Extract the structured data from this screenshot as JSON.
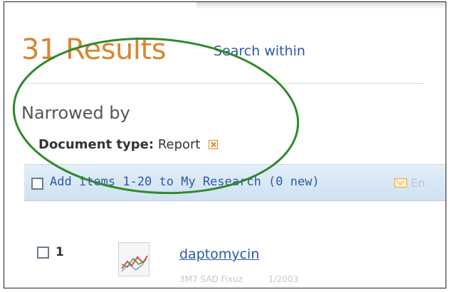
{
  "results": {
    "count": "31 Results",
    "search_within": "Search within"
  },
  "narrowed": {
    "title": "Narrowed by",
    "filter_key": "Document type:",
    "filter_value": "Report"
  },
  "toolbar": {
    "add_prefix": "Add items 1-20 to ",
    "my_research": "My Research (0 new)",
    "email_label": "En"
  },
  "result_items": [
    {
      "number": "1",
      "title": "daptomycin",
      "meta_left": "3M7 SAD Fixuz",
      "meta_right": "1/2003"
    }
  ],
  "colors": {
    "count_orange": "#d9852e",
    "link_blue": "#2b59a8",
    "highlight_green": "#2f8a2a",
    "bar_blue": "#d8e7f4"
  },
  "icons": {
    "remove_filter": "remove-filter-icon",
    "email": "mail-icon",
    "thumbnail": "chart-thumbnail-icon"
  }
}
